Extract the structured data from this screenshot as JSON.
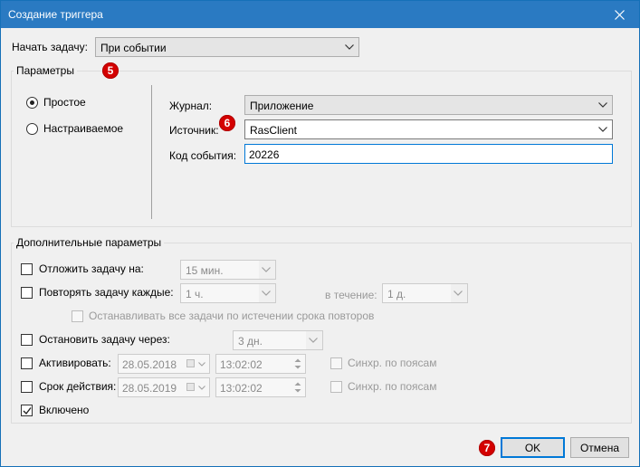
{
  "window": {
    "title": "Создание триггера"
  },
  "start_task": {
    "label": "Начать задачу:",
    "value": "При событии"
  },
  "params_group": {
    "title": "Параметры",
    "radio_simple": "Простое",
    "radio_custom": "Настраиваемое",
    "log_label": "Журнал:",
    "log_value": "Приложение",
    "source_label": "Источник:",
    "source_value": "RasClient",
    "event_code_label": "Код события:",
    "event_code_value": "20226"
  },
  "advanced_group": {
    "title": "Дополнительные параметры",
    "delay_label": "Отложить задачу на:",
    "delay_value": "15 мин.",
    "repeat_label": "Повторять задачу каждые:",
    "repeat_value": "1 ч.",
    "duration_label": "в течение:",
    "duration_value": "1 д.",
    "stop_all_label": "Останавливать все задачи по истечении срока повторов",
    "stop_after_label": "Остановить задачу через:",
    "stop_after_value": "3 дн.",
    "activate_label": "Активировать:",
    "activate_date": "28.05.2018",
    "activate_time": "13:02:02",
    "activate_sync_label": "Синхр. по поясам",
    "expire_label": "Срок действия:",
    "expire_date": "28.05.2019",
    "expire_time": "13:02:02",
    "expire_sync_label": "Синхр. по поясам",
    "enabled_label": "Включено"
  },
  "badges": {
    "b5": "5",
    "b6": "6",
    "b7": "7"
  },
  "buttons": {
    "ok": "OK",
    "cancel": "Отмена"
  },
  "colors": {
    "titlebar": "#2a7ac2",
    "badge": "#d40000",
    "focus": "#0078d7"
  },
  "icons": [
    "close-icon",
    "chevron-down-icon",
    "checkmark-icon",
    "calendar-icon",
    "spin-arrows-icon"
  ]
}
